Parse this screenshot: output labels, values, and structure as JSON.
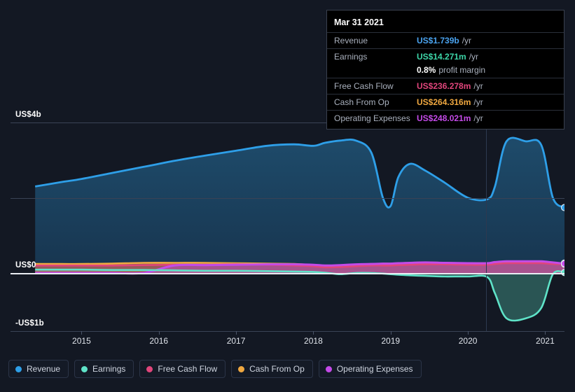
{
  "chart_data": {
    "type": "area",
    "title": "",
    "xlabel": "",
    "ylabel": "",
    "currency": "US$",
    "grid": true,
    "legend_position": "bottom",
    "xlim": [
      2014.38,
      2021.25
    ],
    "ylim": [
      -1.0,
      4.0
    ],
    "y_ticks": [
      {
        "value": 4.0,
        "label": "US$4b"
      },
      {
        "value": 2.0,
        "label": ""
      },
      {
        "value": 0.0,
        "label": "US$0"
      },
      {
        "value": -1.0,
        "label": "-US$1b"
      }
    ],
    "x_ticks": [
      {
        "value": 2015,
        "label": "2015"
      },
      {
        "value": 2016,
        "label": "2016"
      },
      {
        "value": 2017,
        "label": "2017"
      },
      {
        "value": 2018,
        "label": "2018"
      },
      {
        "value": 2019,
        "label": "2019"
      },
      {
        "value": 2020,
        "label": "2020"
      },
      {
        "value": 2021,
        "label": "2021"
      }
    ],
    "forecast_divider_x": 2020.3,
    "x": [
      2014.4,
      2014.75,
      2015.0,
      2015.4,
      2015.8,
      2016.2,
      2016.6,
      2017.0,
      2017.4,
      2017.75,
      2018.0,
      2018.15,
      2018.35,
      2018.55,
      2018.75,
      2018.9,
      2019.0,
      2019.1,
      2019.25,
      2019.45,
      2019.7,
      2020.0,
      2020.25,
      2020.35,
      2020.5,
      2020.75,
      2020.95,
      2021.1,
      2021.25
    ],
    "series": [
      {
        "name": "Revenue",
        "color": "#2e9fe8",
        "unit": "b",
        "values": [
          2.3,
          2.42,
          2.5,
          2.66,
          2.82,
          2.98,
          3.12,
          3.25,
          3.38,
          3.42,
          3.38,
          3.46,
          3.52,
          3.52,
          3.2,
          2.0,
          1.78,
          2.55,
          2.9,
          2.72,
          2.4,
          2.0,
          1.96,
          2.3,
          3.5,
          3.5,
          3.4,
          2.0,
          1.739
        ]
      },
      {
        "name": "Earnings",
        "color": "#5fe3c8",
        "unit": "m",
        "values": [
          0.09,
          0.09,
          0.09,
          0.08,
          0.08,
          0.07,
          0.06,
          0.06,
          0.05,
          0.04,
          0.03,
          0.01,
          -0.02,
          0.0,
          0.0,
          -0.01,
          -0.02,
          -0.03,
          -0.04,
          -0.05,
          -0.06,
          -0.06,
          -0.07,
          -0.35,
          -0.78,
          -0.78,
          -0.6,
          -0.02,
          0.014271
        ]
      },
      {
        "name": "Free Cash Flow",
        "color": "#e0457b",
        "unit": "m",
        "values": [
          0.2,
          0.2,
          0.2,
          0.2,
          0.21,
          0.22,
          0.22,
          0.23,
          0.22,
          0.2,
          0.18,
          0.15,
          0.16,
          0.18,
          0.2,
          0.2,
          0.2,
          0.21,
          0.22,
          0.23,
          0.23,
          0.22,
          0.22,
          0.24,
          0.26,
          0.26,
          0.26,
          0.24,
          0.236278
        ]
      },
      {
        "name": "Cash From Op",
        "color": "#f0a840",
        "unit": "m",
        "values": [
          0.24,
          0.24,
          0.24,
          0.25,
          0.27,
          0.27,
          0.27,
          0.26,
          0.25,
          0.24,
          0.21,
          0.18,
          0.2,
          0.22,
          0.24,
          0.25,
          0.25,
          0.26,
          0.27,
          0.28,
          0.27,
          0.26,
          0.26,
          0.28,
          0.3,
          0.3,
          0.3,
          0.27,
          0.264316
        ]
      },
      {
        "name": "Operating Expenses",
        "color": "#c44ae8",
        "unit": "m",
        "values": [
          0.0,
          0.0,
          0.0,
          0.0,
          0.0,
          0.2,
          0.21,
          0.22,
          0.23,
          0.23,
          0.22,
          0.2,
          0.21,
          0.23,
          0.24,
          0.25,
          0.25,
          0.26,
          0.27,
          0.28,
          0.27,
          0.26,
          0.26,
          0.29,
          0.31,
          0.31,
          0.31,
          0.28,
          0.248021
        ]
      }
    ]
  },
  "legend": {
    "items": [
      {
        "label": "Revenue",
        "color": "#2e9fe8"
      },
      {
        "label": "Earnings",
        "color": "#5fe3c8"
      },
      {
        "label": "Free Cash Flow",
        "color": "#e0457b"
      },
      {
        "label": "Cash From Op",
        "color": "#f0a840"
      },
      {
        "label": "Operating Expenses",
        "color": "#c44ae8"
      }
    ]
  },
  "tooltip": {
    "date": "Mar 31 2021",
    "rows": [
      {
        "key": "Revenue",
        "value": "US$1.739b",
        "unit": "/yr",
        "color": "#4aa3ef"
      },
      {
        "key": "Earnings",
        "value": "US$14.271m",
        "unit": "/yr",
        "color": "#3dd6a8"
      },
      {
        "key": "Free Cash Flow",
        "value": "US$236.278m",
        "unit": "/yr",
        "color": "#e0457b"
      },
      {
        "key": "Cash From Op",
        "value": "US$264.316m",
        "unit": "/yr",
        "color": "#f0a840"
      },
      {
        "key": "Operating Expenses",
        "value": "US$248.021m",
        "unit": "/yr",
        "color": "#c44ae8"
      }
    ],
    "profit_margin_value": "0.8%",
    "profit_margin_label": "profit margin"
  }
}
